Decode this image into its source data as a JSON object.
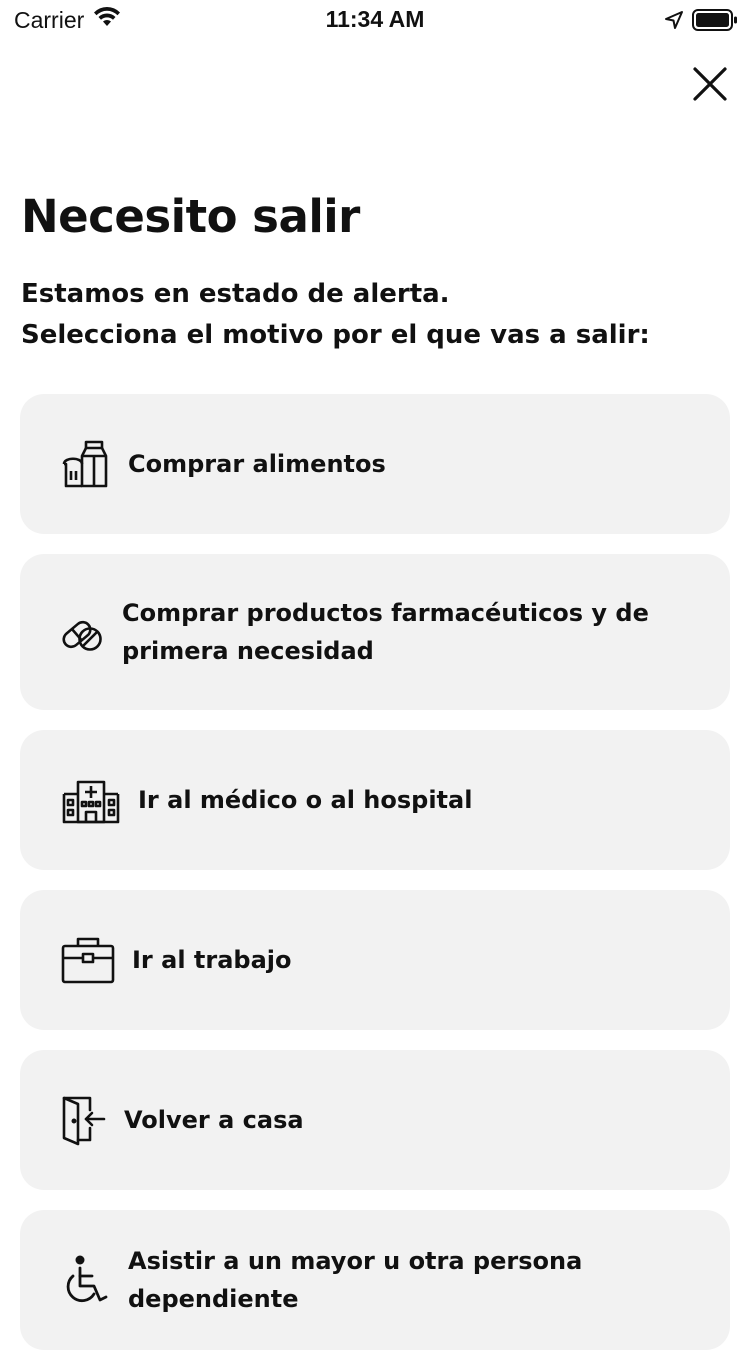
{
  "status_bar": {
    "carrier": "Carrier",
    "time": "11:34 AM",
    "icons": [
      "wifi-icon",
      "location-arrow-icon",
      "battery-icon"
    ]
  },
  "header": {
    "close_icon": "close-icon"
  },
  "page": {
    "title": "Necesito salir",
    "subtitle_line1": "Estamos en estado de alerta.",
    "subtitle_line2": "Selecciona el motivo por el que vas a salir:"
  },
  "options": [
    {
      "label": "Comprar alimentos",
      "icon": "groceries-icon"
    },
    {
      "label": "Comprar productos farmacéuticos y de primera necesidad",
      "icon": "pills-icon"
    },
    {
      "label": "Ir al médico o al hospital",
      "icon": "hospital-icon"
    },
    {
      "label": "Ir al trabajo",
      "icon": "briefcase-icon"
    },
    {
      "label": "Volver a casa",
      "icon": "door-enter-icon"
    },
    {
      "label": "Asistir a un mayor u otra persona dependiente",
      "icon": "wheelchair-icon"
    }
  ],
  "colors": {
    "card_background": "#f2f2f2",
    "text": "#111111",
    "background": "#ffffff"
  }
}
